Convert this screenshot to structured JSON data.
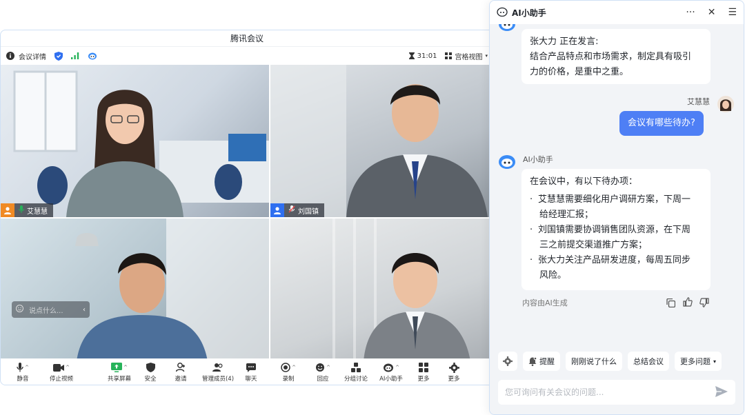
{
  "meeting": {
    "window_title": "腾讯会议",
    "info_label": "会议详情",
    "timer": "31:01",
    "view_label": "宫格视图",
    "participants": [
      {
        "name": "艾慧慧"
      },
      {
        "name": "刘国镇"
      }
    ],
    "chat_placeholder": "说点什么...",
    "toolbar": [
      {
        "label": "静音",
        "icon": "mic-icon"
      },
      {
        "label": "停止视频",
        "icon": "video-icon"
      },
      {
        "label": "共享屏幕",
        "icon": "share-screen-icon"
      },
      {
        "label": "安全",
        "icon": "shield-icon"
      },
      {
        "label": "邀请",
        "icon": "invite-icon"
      },
      {
        "label": "管理成员(4)",
        "icon": "members-icon"
      },
      {
        "label": "聊天",
        "icon": "chat-icon"
      },
      {
        "label": "录制",
        "icon": "record-icon"
      },
      {
        "label": "回应",
        "icon": "reaction-icon"
      },
      {
        "label": "分组讨论",
        "icon": "breakout-icon"
      },
      {
        "label": "AI小助手",
        "icon": "ai-assistant-icon"
      },
      {
        "label": "更多",
        "icon": "apps-icon"
      },
      {
        "label": "更多",
        "icon": "settings-icon"
      }
    ],
    "colors": {
      "accent": "#4e7ff5",
      "mic_active": "#27b35a"
    }
  },
  "assistant": {
    "title": "AI小助手",
    "speaking_header": "张大力 正在发言:",
    "speaking_text_1": "结合产品特点和市场需求，制定具有吸引",
    "speaking_text_2": "力的价格，是重中之重。",
    "user_name": "艾慧慧",
    "user_question": "会议有哪些待办?",
    "bot_name": "AI小助手",
    "answer_intro": "在会议中，有以下待办项：",
    "todos": [
      {
        "line1": "艾慧慧需要细化用户调研方案，下周一",
        "line2": "给经理汇报；"
      },
      {
        "line1": "刘国镇需要协调销售团队资源，在下周",
        "line2": "三之前提交渠道推广方案；"
      },
      {
        "line1": "张大力关注产品研发进度，每周五同步",
        "line2": "风险。"
      }
    ],
    "generated_note": "内容由AI生成",
    "quick_actions": {
      "remind": "提醒",
      "just_said": "刚刚说了什么",
      "summary": "总结会议",
      "more": "更多问题"
    },
    "input_placeholder": "您可询问有关会议的问题..."
  }
}
